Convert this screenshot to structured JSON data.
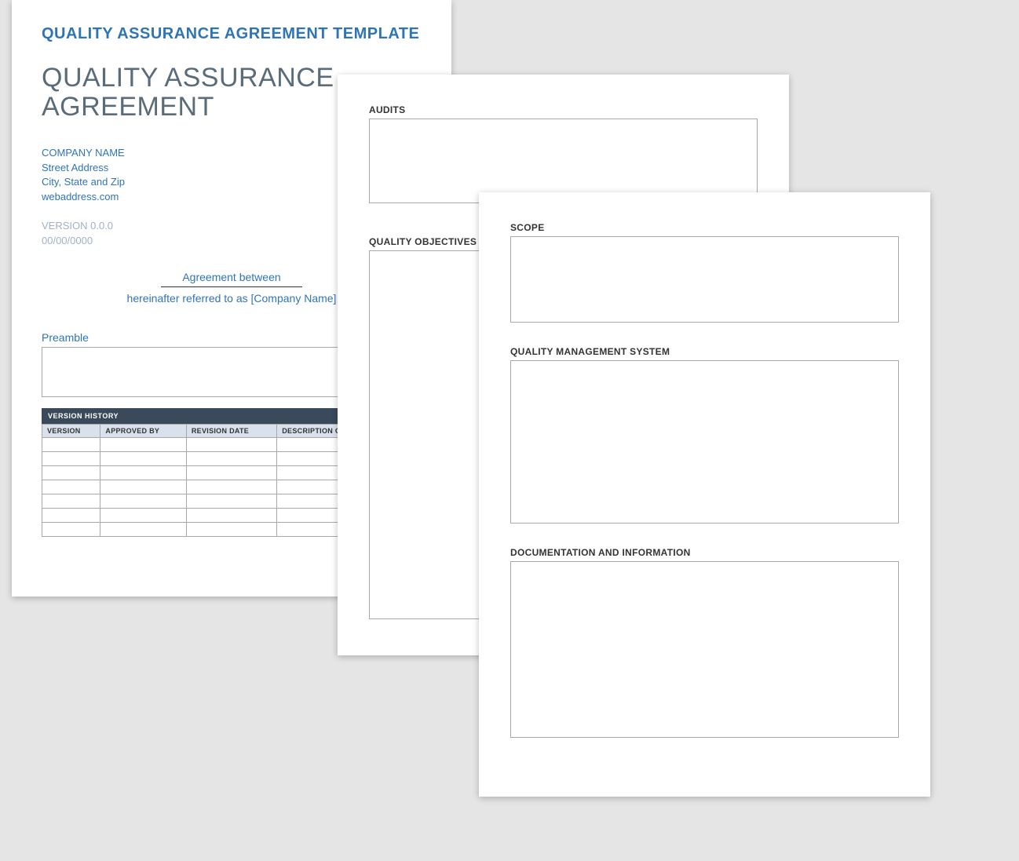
{
  "page1": {
    "template_title": "QUALITY ASSURANCE AGREEMENT TEMPLATE",
    "doc_title": "QUALITY ASSURANCE AGREEMENT",
    "company": {
      "name": "COMPANY NAME",
      "street": "Street Address",
      "citystatezip": "City, State and Zip",
      "web": "webaddress.com"
    },
    "version": "VERSION 0.0.0",
    "date": "00/00/0000",
    "agreement_between": "Agreement between",
    "referred_as": "hereinafter referred to as [Company Name]",
    "preamble_label": "Preamble",
    "version_history_header": "VERSION HISTORY",
    "vh_columns": [
      "VERSION",
      "APPROVED BY",
      "REVISION DATE",
      "DESCRIPTION OF CHANGE"
    ],
    "vh_rows": 7
  },
  "page2": {
    "audits_label": "AUDITS",
    "objectives_label": "QUALITY OBJECTIVES"
  },
  "page3": {
    "scope_label": "SCOPE",
    "qms_label": "QUALITY MANAGEMENT SYSTEM",
    "doc_label": "DOCUMENTATION AND INFORMATION"
  }
}
